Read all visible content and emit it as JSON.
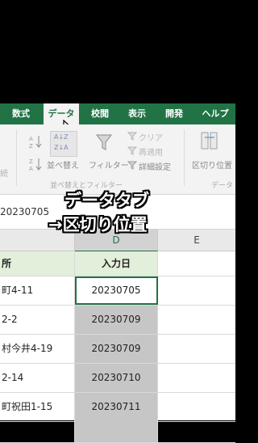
{
  "tabs": [
    {
      "label": "数式"
    },
    {
      "label": "データ"
    },
    {
      "label": "校閲"
    },
    {
      "label": "表示"
    },
    {
      "label": "開発"
    },
    {
      "label": "ヘルプ"
    }
  ],
  "ribbon": {
    "sort": "並べ替え",
    "filter": "フィルター",
    "clear": "クリア",
    "reapply": "再適用",
    "advanced": "詳細設定",
    "group_label_left": "並べ替えとフィルター",
    "text_to_columns": "区切り位置",
    "group_label_data": "データ",
    "left_partial": "続",
    "az_top": "Z↓A",
    "az_bottom": "A↓Z"
  },
  "formula_bar": {
    "value": "20230705"
  },
  "columns": {
    "d": "D",
    "e": "E"
  },
  "table": {
    "header_b": "所",
    "header_d": "入力日",
    "rows": [
      {
        "b": "町4-11",
        "d": "20230705"
      },
      {
        "b": "2-2",
        "d": "20230709"
      },
      {
        "b": "村今井4-19",
        "d": "20230709"
      },
      {
        "b": "2-14",
        "d": "20230710"
      },
      {
        "b": "町祝田1-15",
        "d": "20230711"
      },
      {
        "b": "",
        "d": ""
      }
    ]
  },
  "overlay": {
    "line1": "データタブ",
    "line2": "→区切り位置"
  },
  "colors": {
    "accent": "#217346",
    "selected_fill": "#c6c6c6",
    "header_fill": "#e2efda"
  }
}
